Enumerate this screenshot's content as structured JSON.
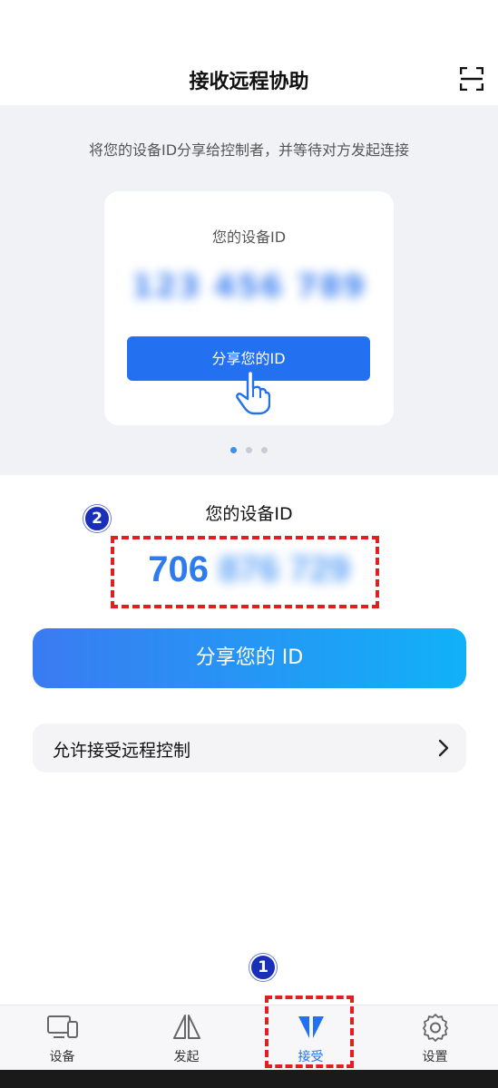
{
  "header": {
    "title": "接收远程协助",
    "scan_icon": "scan-icon"
  },
  "guide": {
    "instruction": "将您的设备ID分享给控制者，并等待对方发起连接",
    "card_label": "您的设备ID",
    "card_id": "123 456 789",
    "card_button": "分享您的ID",
    "pager": {
      "pages": 3,
      "current": 1
    }
  },
  "device": {
    "label": "您的设备ID",
    "id_visible": "706",
    "id_hidden": "876 729"
  },
  "share_button": "分享您的 ID",
  "allow_row": {
    "label": "允许接受远程控制"
  },
  "annotations": {
    "badge_1": "1",
    "badge_2": "2",
    "highlight_color": "#e02020"
  },
  "tabs": [
    {
      "label": "设备",
      "icon": "devices-icon",
      "active": false
    },
    {
      "label": "发起",
      "icon": "initiate-icon",
      "active": false
    },
    {
      "label": "接受",
      "icon": "receive-icon",
      "active": true
    },
    {
      "label": "设置",
      "icon": "gear-icon",
      "active": false
    }
  ],
  "colors": {
    "accent": "#2370f0",
    "gradient_start": "#3a7bf1",
    "gradient_end": "#11b1f8",
    "id_text": "#2d7cee"
  }
}
